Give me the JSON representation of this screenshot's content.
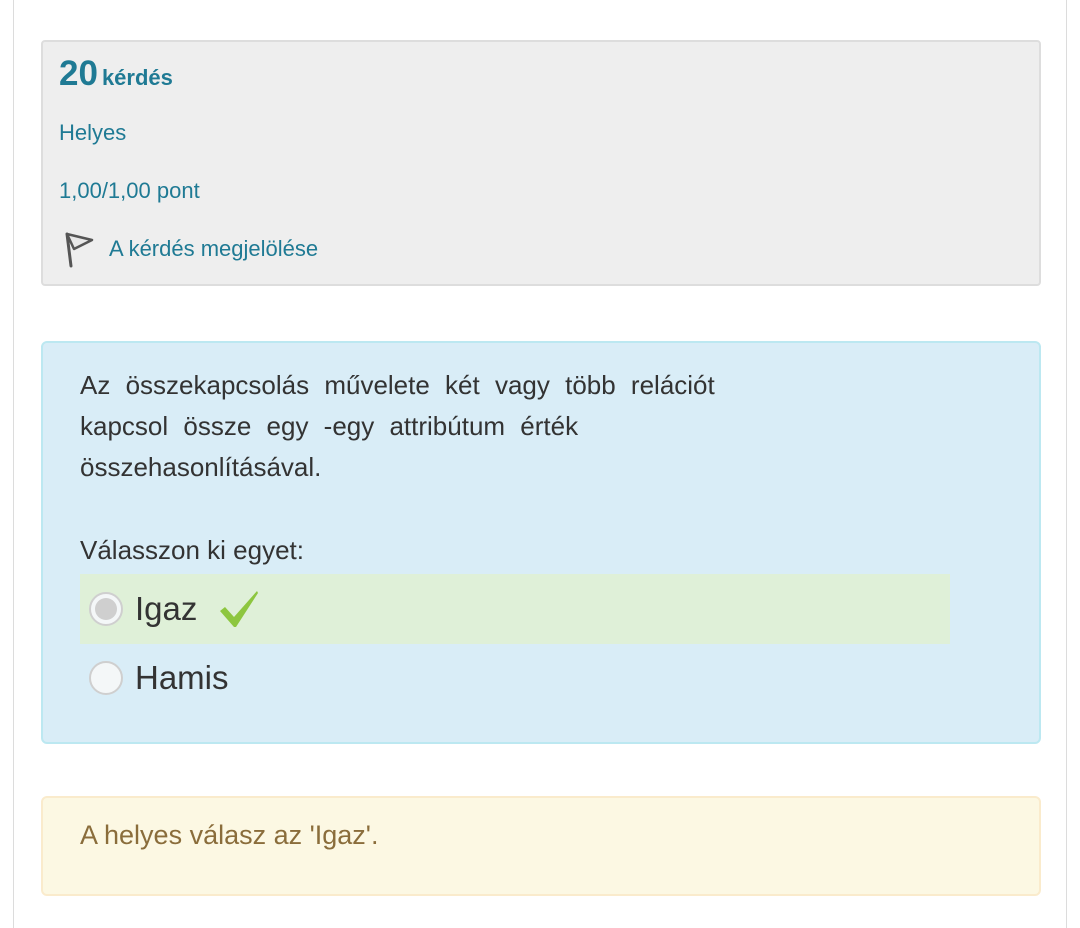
{
  "info": {
    "question_number": "20",
    "question_label": "kérdés",
    "state": "Helyes",
    "grade": "1,00/1,00 pont",
    "flag_label": "A kérdés megjelölése",
    "flag_icon": "flag-icon"
  },
  "question": {
    "lines": [
      "Az összekapcsolás művelete két vagy több relációt",
      "kapcsol össze egy -egy attribútum érték",
      "összehasonlításával."
    ],
    "prompt": "Válasszon ki egyet:",
    "answers": [
      {
        "label": "Igaz",
        "selected": true,
        "correct": true
      },
      {
        "label": "Hamis",
        "selected": false,
        "correct": false
      }
    ],
    "correct_icon": "check-icon"
  },
  "feedback": {
    "text": "A helyes válasz az 'Igaz'."
  },
  "colors": {
    "link": "#1f7a94",
    "question_bg": "#d9edf7",
    "correct_bg": "#dff0d8",
    "feedback_bg": "#fcf8e3",
    "feedback_text": "#8a6d3b",
    "check": "#8dc63f"
  }
}
